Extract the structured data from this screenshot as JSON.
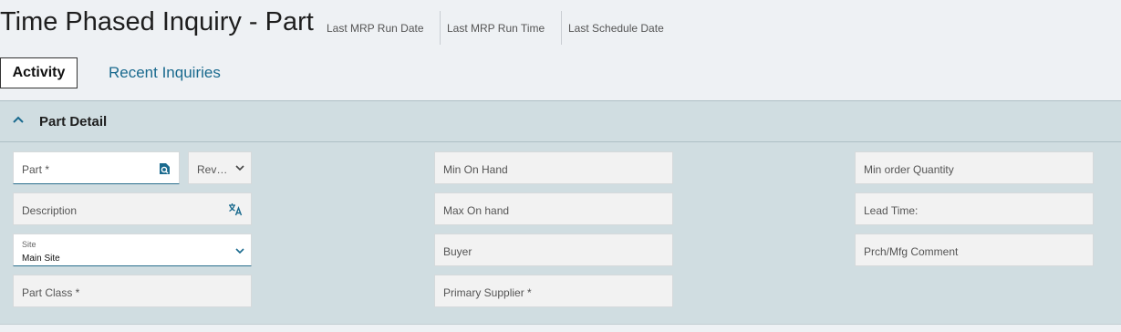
{
  "header": {
    "title": "Time Phased Inquiry - Part",
    "meta": [
      "Last MRP Run Date",
      "Last MRP Run Time",
      "Last Schedule Date"
    ]
  },
  "tabs": {
    "active": "Activity",
    "link": "Recent Inquiries"
  },
  "panel": {
    "title": "Part Detail",
    "fields": {
      "part": "Part *",
      "rev": "Rev…",
      "description": "Description",
      "site_label": "Site",
      "site_value": "Main Site",
      "part_class": "Part Class *",
      "min_on_hand": "Min On Hand",
      "max_on_hand": "Max On hand",
      "buyer": "Buyer",
      "primary_supplier": "Primary Supplier *",
      "min_order_qty": "Min order Quantity",
      "lead_time": "Lead Time:",
      "prch_mfg_comment": "Prch/Mfg Comment"
    }
  },
  "icons": {
    "part_search": "search-document-icon",
    "translate": "translate-icon",
    "dropdown": "chevron-down-icon",
    "collapse": "chevron-up-icon"
  },
  "colors": {
    "accent": "#1a6a8e",
    "panel_bg": "#d0dde1",
    "page_bg": "#eef1f4"
  }
}
